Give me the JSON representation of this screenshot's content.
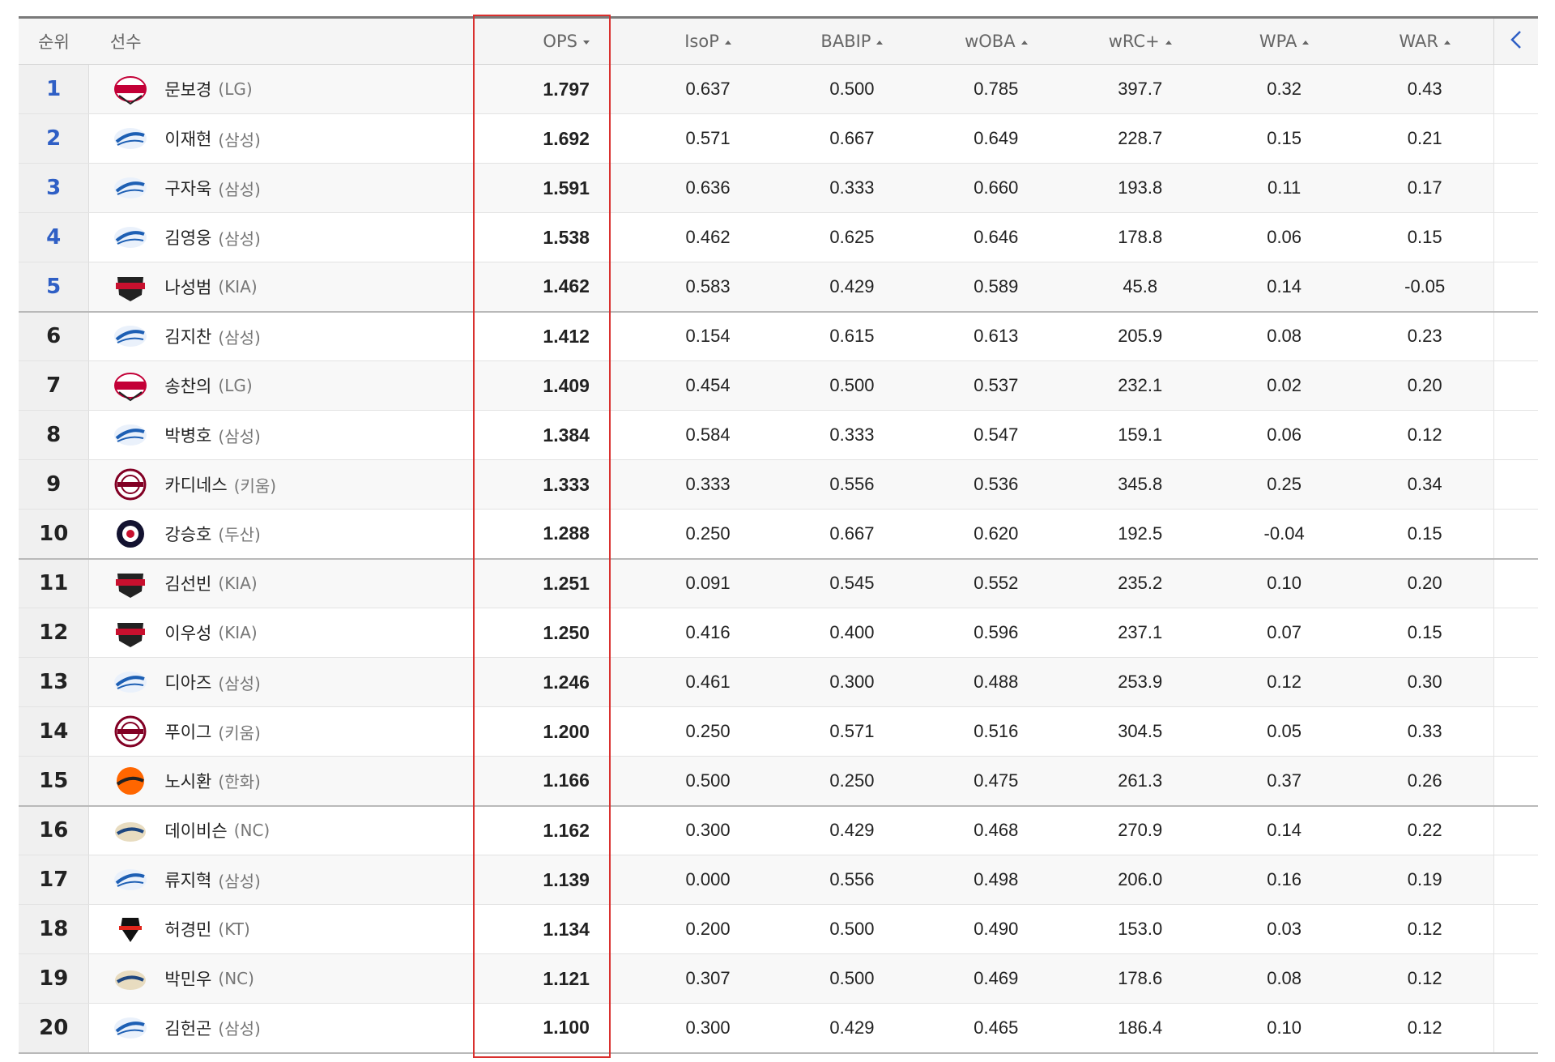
{
  "colors": {
    "rank_top": "#2f5fc5",
    "highlight": "#d9302e",
    "header_bg": "#f5f5f5",
    "row_alt": "#f8f8f8"
  },
  "headers": {
    "rank": "순위",
    "player": "선수",
    "ops": "OPS",
    "isop": "IsoP",
    "babip": "BABIP",
    "woba": "wOBA",
    "wrc": "wRC+",
    "wpa": "WPA",
    "war": "WAR"
  },
  "nav_icon": "chevron-left-icon",
  "rows": [
    {
      "rank": "1",
      "name": "문보경",
      "team": "(LG)",
      "logo": "lg",
      "ops": "1.797",
      "isop": "0.637",
      "babip": "0.500",
      "woba": "0.785",
      "wrc": "397.7",
      "wpa": "0.32",
      "war": "0.43"
    },
    {
      "rank": "2",
      "name": "이재현",
      "team": "(삼성)",
      "logo": "samsung",
      "ops": "1.692",
      "isop": "0.571",
      "babip": "0.667",
      "woba": "0.649",
      "wrc": "228.7",
      "wpa": "0.15",
      "war": "0.21"
    },
    {
      "rank": "3",
      "name": "구자욱",
      "team": "(삼성)",
      "logo": "samsung",
      "ops": "1.591",
      "isop": "0.636",
      "babip": "0.333",
      "woba": "0.660",
      "wrc": "193.8",
      "wpa": "0.11",
      "war": "0.17"
    },
    {
      "rank": "4",
      "name": "김영웅",
      "team": "(삼성)",
      "logo": "samsung",
      "ops": "1.538",
      "isop": "0.462",
      "babip": "0.625",
      "woba": "0.646",
      "wrc": "178.8",
      "wpa": "0.06",
      "war": "0.15"
    },
    {
      "rank": "5",
      "name": "나성범",
      "team": "(KIA)",
      "logo": "kia",
      "ops": "1.462",
      "isop": "0.583",
      "babip": "0.429",
      "woba": "0.589",
      "wrc": "45.8",
      "wpa": "0.14",
      "war": "-0.05"
    },
    {
      "rank": "6",
      "name": "김지찬",
      "team": "(삼성)",
      "logo": "samsung",
      "ops": "1.412",
      "isop": "0.154",
      "babip": "0.615",
      "woba": "0.613",
      "wrc": "205.9",
      "wpa": "0.08",
      "war": "0.23"
    },
    {
      "rank": "7",
      "name": "송찬의",
      "team": "(LG)",
      "logo": "lg",
      "ops": "1.409",
      "isop": "0.454",
      "babip": "0.500",
      "woba": "0.537",
      "wrc": "232.1",
      "wpa": "0.02",
      "war": "0.20"
    },
    {
      "rank": "8",
      "name": "박병호",
      "team": "(삼성)",
      "logo": "samsung",
      "ops": "1.384",
      "isop": "0.584",
      "babip": "0.333",
      "woba": "0.547",
      "wrc": "159.1",
      "wpa": "0.06",
      "war": "0.12"
    },
    {
      "rank": "9",
      "name": "카디네스",
      "team": "(키움)",
      "logo": "kiwoom",
      "ops": "1.333",
      "isop": "0.333",
      "babip": "0.556",
      "woba": "0.536",
      "wrc": "345.8",
      "wpa": "0.25",
      "war": "0.34"
    },
    {
      "rank": "10",
      "name": "강승호",
      "team": "(두산)",
      "logo": "doosan",
      "ops": "1.288",
      "isop": "0.250",
      "babip": "0.667",
      "woba": "0.620",
      "wrc": "192.5",
      "wpa": "-0.04",
      "war": "0.15"
    },
    {
      "rank": "11",
      "name": "김선빈",
      "team": "(KIA)",
      "logo": "kia",
      "ops": "1.251",
      "isop": "0.091",
      "babip": "0.545",
      "woba": "0.552",
      "wrc": "235.2",
      "wpa": "0.10",
      "war": "0.20"
    },
    {
      "rank": "12",
      "name": "이우성",
      "team": "(KIA)",
      "logo": "kia",
      "ops": "1.250",
      "isop": "0.416",
      "babip": "0.400",
      "woba": "0.596",
      "wrc": "237.1",
      "wpa": "0.07",
      "war": "0.15"
    },
    {
      "rank": "13",
      "name": "디아즈",
      "team": "(삼성)",
      "logo": "samsung",
      "ops": "1.246",
      "isop": "0.461",
      "babip": "0.300",
      "woba": "0.488",
      "wrc": "253.9",
      "wpa": "0.12",
      "war": "0.30"
    },
    {
      "rank": "14",
      "name": "푸이그",
      "team": "(키움)",
      "logo": "kiwoom",
      "ops": "1.200",
      "isop": "0.250",
      "babip": "0.571",
      "woba": "0.516",
      "wrc": "304.5",
      "wpa": "0.05",
      "war": "0.33"
    },
    {
      "rank": "15",
      "name": "노시환",
      "team": "(한화)",
      "logo": "hanwha",
      "ops": "1.166",
      "isop": "0.500",
      "babip": "0.250",
      "woba": "0.475",
      "wrc": "261.3",
      "wpa": "0.37",
      "war": "0.26"
    },
    {
      "rank": "16",
      "name": "데이비슨",
      "team": "(NC)",
      "logo": "nc",
      "ops": "1.162",
      "isop": "0.300",
      "babip": "0.429",
      "woba": "0.468",
      "wrc": "270.9",
      "wpa": "0.14",
      "war": "0.22"
    },
    {
      "rank": "17",
      "name": "류지혁",
      "team": "(삼성)",
      "logo": "samsung",
      "ops": "1.139",
      "isop": "0.000",
      "babip": "0.556",
      "woba": "0.498",
      "wrc": "206.0",
      "wpa": "0.16",
      "war": "0.19"
    },
    {
      "rank": "18",
      "name": "허경민",
      "team": "(KT)",
      "logo": "kt",
      "ops": "1.134",
      "isop": "0.200",
      "babip": "0.500",
      "woba": "0.490",
      "wrc": "153.0",
      "wpa": "0.03",
      "war": "0.12"
    },
    {
      "rank": "19",
      "name": "박민우",
      "team": "(NC)",
      "logo": "nc",
      "ops": "1.121",
      "isop": "0.307",
      "babip": "0.500",
      "woba": "0.469",
      "wrc": "178.6",
      "wpa": "0.08",
      "war": "0.12"
    },
    {
      "rank": "20",
      "name": "김헌곤",
      "team": "(삼성)",
      "logo": "samsung",
      "ops": "1.100",
      "isop": "0.300",
      "babip": "0.429",
      "woba": "0.465",
      "wrc": "186.4",
      "wpa": "0.10",
      "war": "0.12"
    }
  ]
}
